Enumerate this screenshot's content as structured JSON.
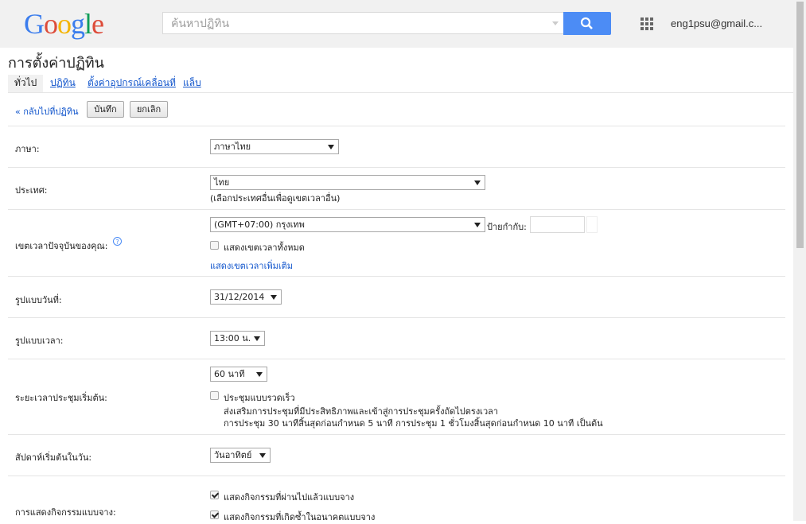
{
  "header": {
    "logo": "Google",
    "search_placeholder": "ค้นหาปฏิทิน",
    "account": "eng1psu@gmail.c..."
  },
  "page": {
    "title": "การตั้งค่าปฏิทิน",
    "tabs": [
      "ทั่วไป",
      "ปฏิทิน",
      "ตั้งค่าอุปกรณ์เคลื่อนที่",
      "แล็บ"
    ],
    "active_tab": "ทั่วไป",
    "back_link": "« กลับไปที่ปฏิทิน",
    "save_button": "บันทึก",
    "cancel_button": "ยกเลิก"
  },
  "settings": {
    "language": {
      "label": "ภาษา:",
      "value": "ภาษาไทย"
    },
    "country": {
      "label": "ประเทศ:",
      "value": "ไทย",
      "hint": "(เลือกประเทศอื่นเพื่อดูเขตเวลาอื่น)"
    },
    "timezone": {
      "label": "เขตเวลาปัจจุบันของคุณ:",
      "value": "(GMT+07:00) กรุงเทพ",
      "tag_label": "ป้ายกำกับ:",
      "tag_value": "",
      "show_all_label": "แสดงเขตเวลาทั้งหมด",
      "show_all_checked": false,
      "more_link": "แสดงเขตเวลาเพิ่มเติม"
    },
    "date_format": {
      "label": "รูปแบบวันที่:",
      "value": "31/12/2014"
    },
    "time_format": {
      "label": "รูปแบบเวลา:",
      "value": "13:00 น."
    },
    "meeting_length": {
      "label": "ระยะเวลาประชุมเริ่มต้น:",
      "value": "60 นาที",
      "speedy_label": "ประชุมแบบรวดเร็ว",
      "speedy_checked": false,
      "speedy_desc_1": "ส่งเสริมการประชุมที่มีประสิทธิภาพและเข้าสู่การประชุมครั้งถัดไปตรงเวลา",
      "speedy_desc_2": "การประชุม 30 นาทีสิ้นสุดก่อนกำหนด 5 นาที การประชุม 1 ชั่วโมงสิ้นสุดก่อนกำหนด 10 นาที เป็นต้น"
    },
    "week_start": {
      "label": "สัปดาห์เริ่มต้นในวัน:",
      "value": "วันอาทิตย์"
    },
    "dim_events": {
      "label": "การแสดงกิจกรรมแบบจาง:",
      "past_label": "แสดงกิจกรรมที่ผ่านไปแล้วแบบจาง",
      "past_checked": true,
      "recurring_label": "แสดงกิจกรรมที่เกิดซ้ำในอนาคตแบบจาง",
      "recurring_checked": true
    }
  },
  "colors": {
    "link": "#1155cc",
    "search_button": "#4c8cf5",
    "google_blue": "#3b7ded",
    "google_red": "#dd4b39",
    "google_yellow": "#f4b400",
    "google_green": "#0f9d58"
  }
}
